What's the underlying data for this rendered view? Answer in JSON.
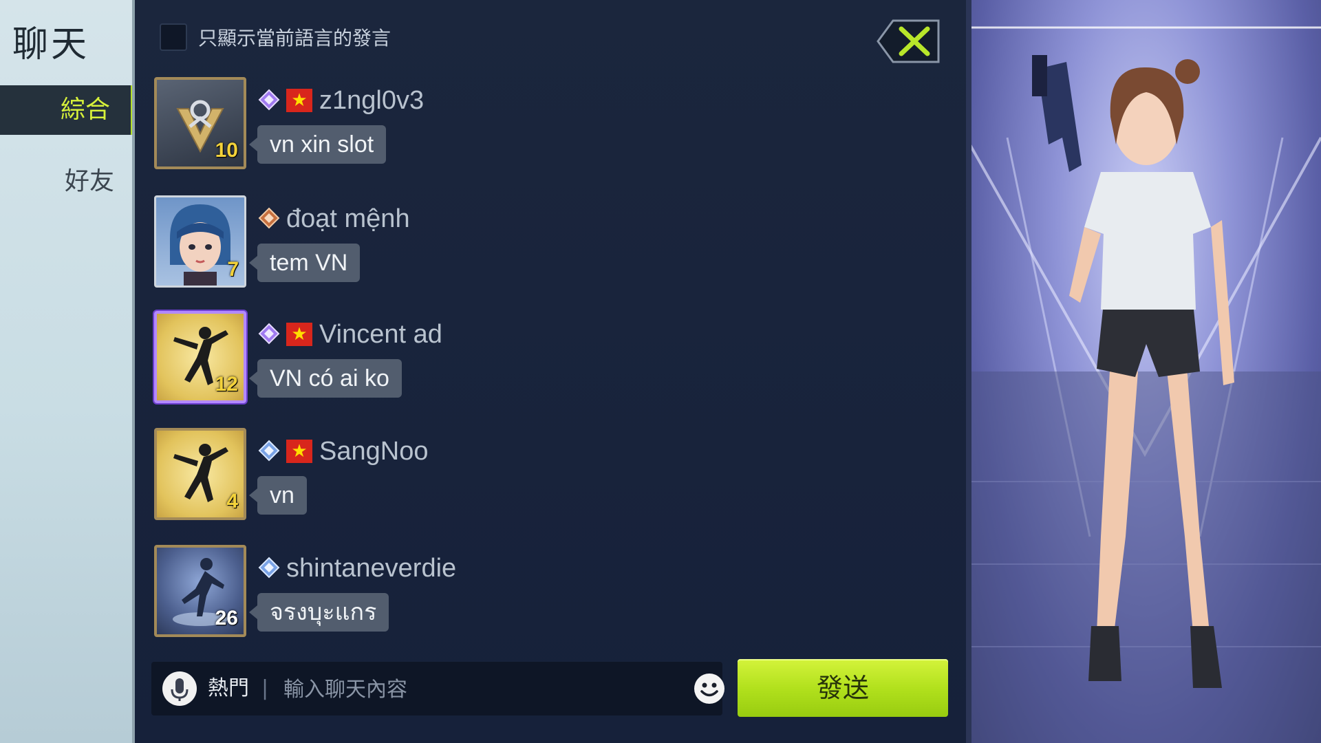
{
  "sidebar": {
    "title": "聊天",
    "tabs": [
      {
        "label": "綜合",
        "active": true
      },
      {
        "label": "好友",
        "active": false
      }
    ]
  },
  "filter": {
    "checked": false,
    "label": "只顯示當前語言的發言"
  },
  "close_icon": "close-x-icon",
  "messages": [
    {
      "username": "z1ngl0v3",
      "text": "vn xin slot",
      "level": "10",
      "flag": "vietnam",
      "rank_icon": "purple-diamond-rank-icon"
    },
    {
      "username": "đoạt mệnh",
      "text": "tem VN",
      "level": "7",
      "flag": null,
      "rank_icon": "bronze-diamond-rank-icon"
    },
    {
      "username": "Vincent ad",
      "text": "VN có ai ko",
      "level": "12",
      "flag": "vietnam",
      "rank_icon": "purple-diamond-rank-icon"
    },
    {
      "username": "SangNoo",
      "text": "vn",
      "level": "4",
      "flag": "vietnam",
      "rank_icon": "blue-diamond-rank-icon"
    },
    {
      "username": "shintaneverdie",
      "text": "จรงบุะแกร",
      "level": "26",
      "flag": null,
      "rank_icon": "blue-diamond-rank-icon"
    }
  ],
  "input": {
    "hot_label": "熱門",
    "divider": "|",
    "placeholder": "輸入聊天內容",
    "value": ""
  },
  "send_label": "發送",
  "colors": {
    "accent_green": "#b6e02a",
    "panel_bg": "#18233a",
    "bubble_bg": "#525d6e",
    "flag_red": "#d8261c"
  }
}
